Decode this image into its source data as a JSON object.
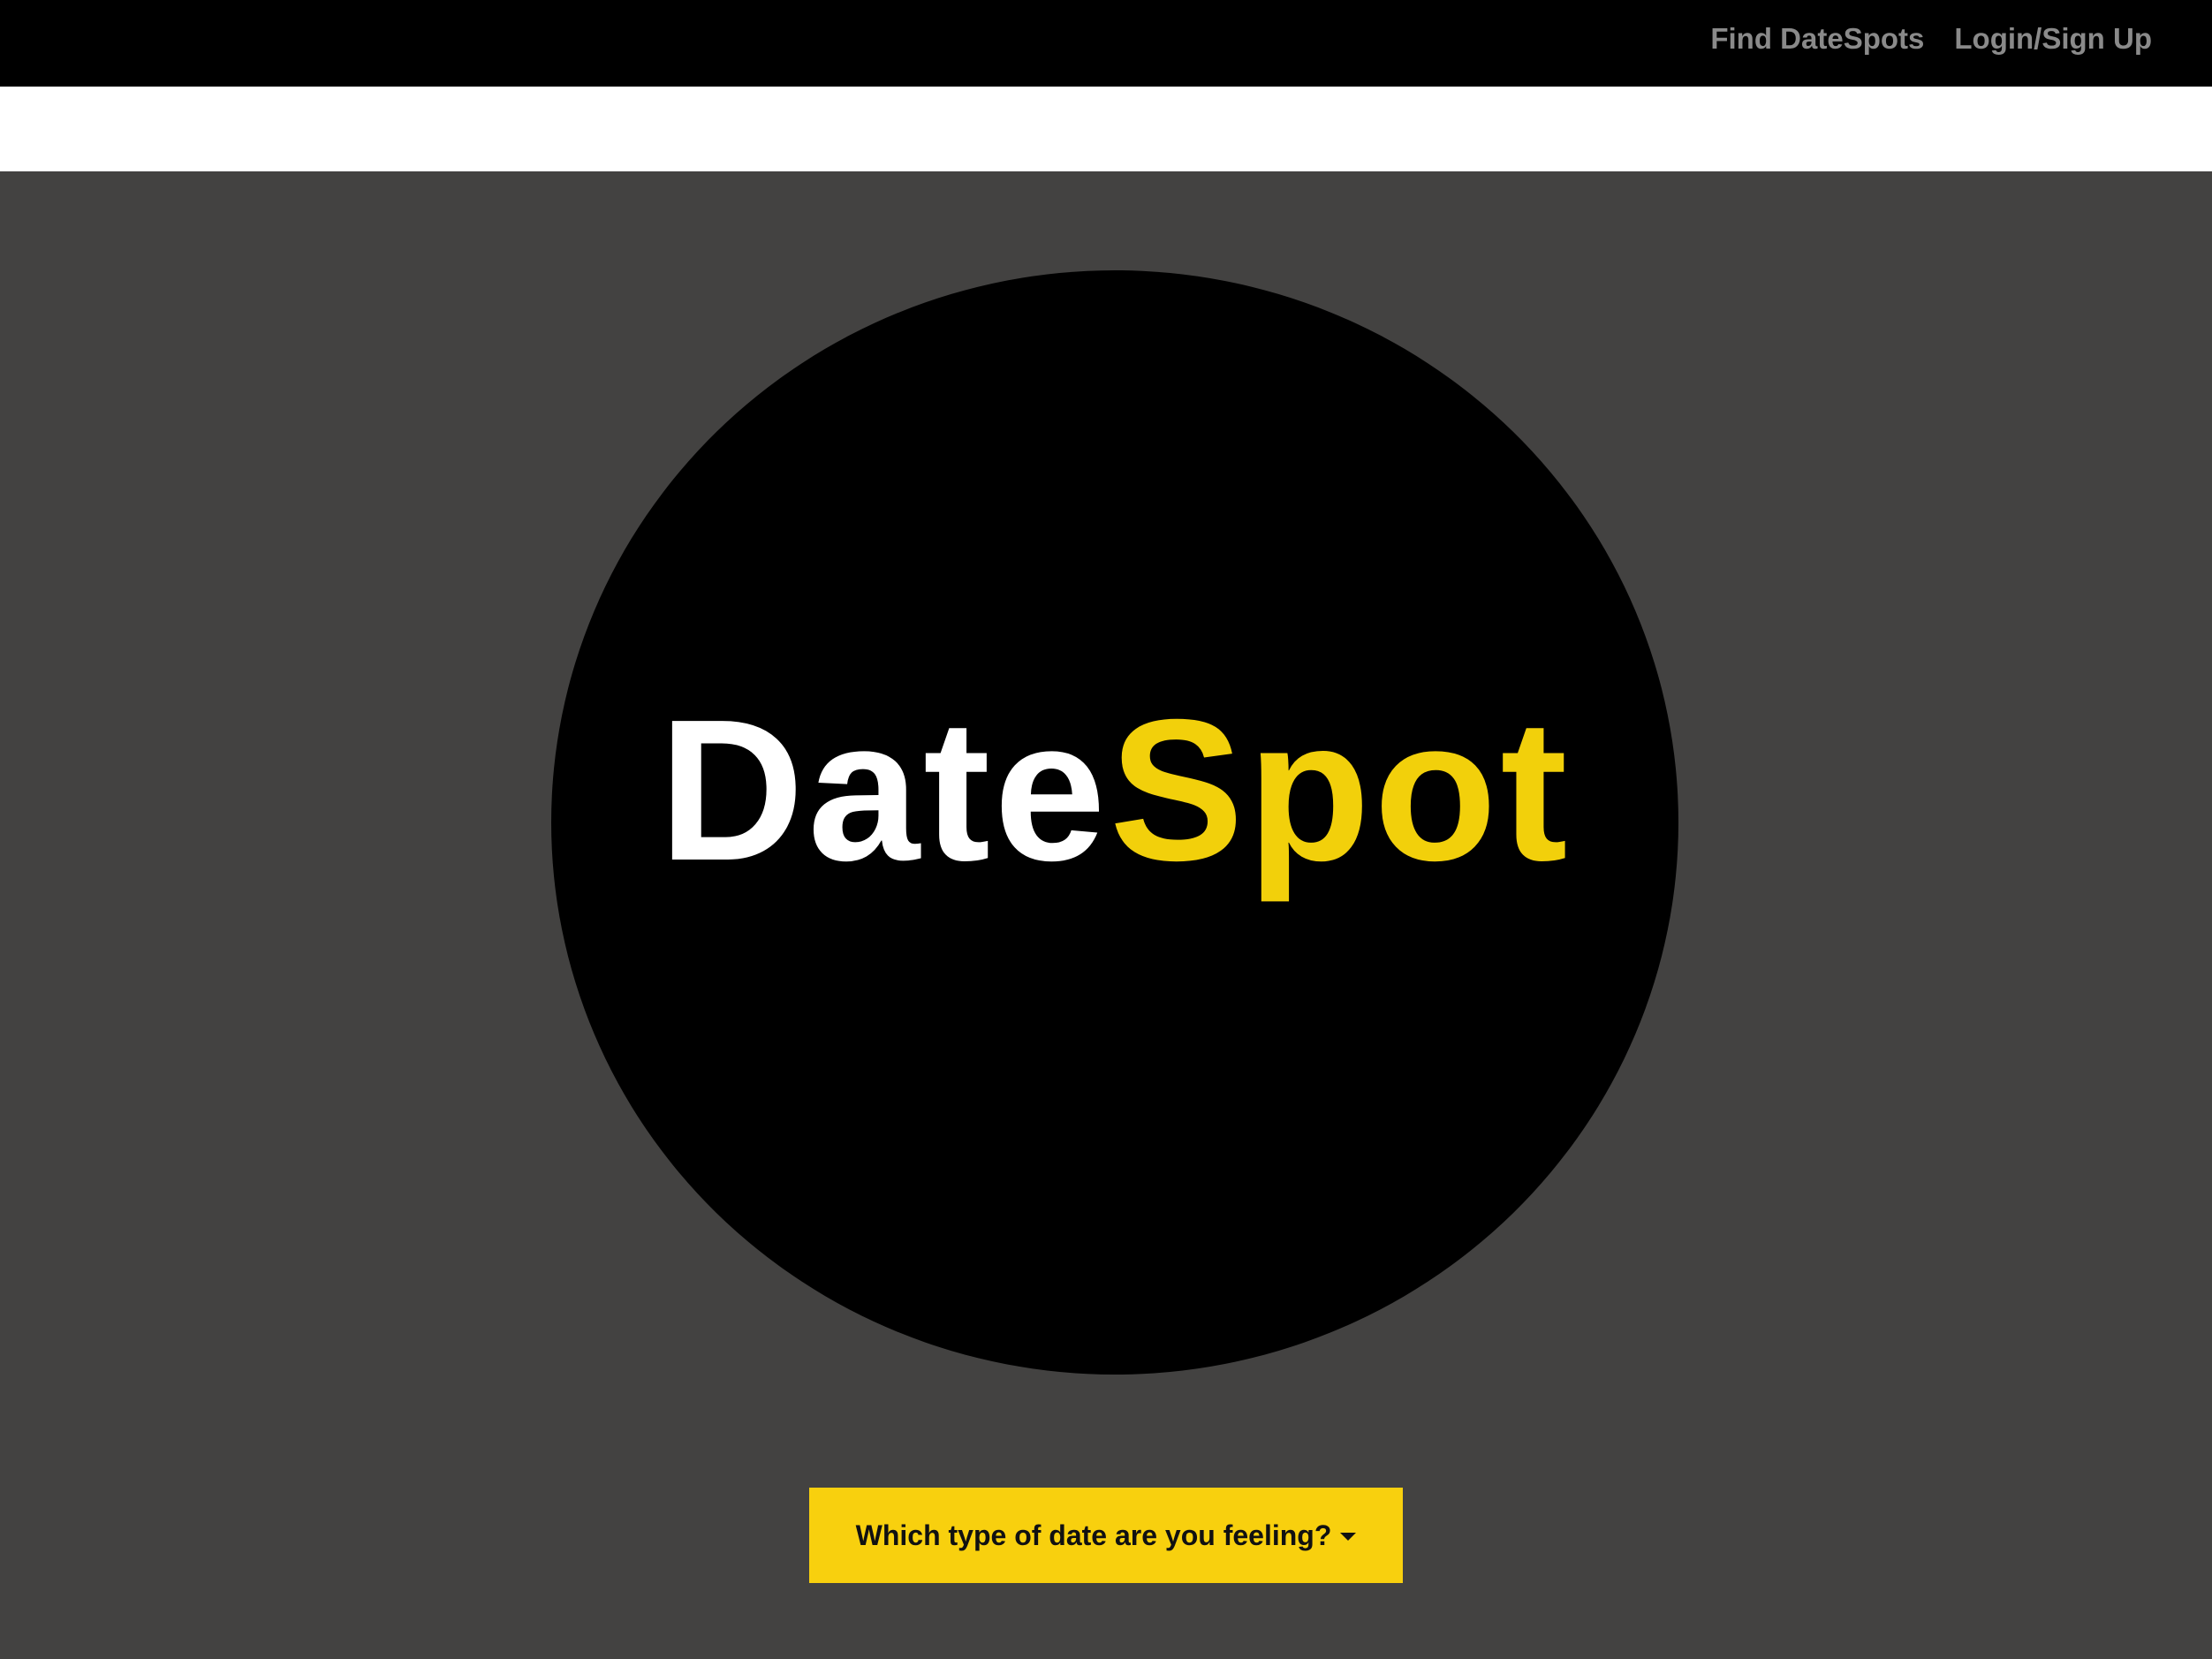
{
  "navbar": {
    "links": [
      {
        "label": "Find DateSpots"
      },
      {
        "label": "Login/Sign Up"
      }
    ]
  },
  "logo": {
    "part1": "Date",
    "part2": "Spot",
    "colors": {
      "part1": "#ffffff",
      "part2": "#f2d00b",
      "circle": "#000000"
    }
  },
  "dropdown": {
    "label": "Which type of date are you feeling?",
    "icon": "caret-down-icon",
    "color": "#f8d00e"
  },
  "theme": {
    "background": "#434241",
    "navbar_bg": "#000000",
    "nav_text": "#8a8a8a"
  }
}
